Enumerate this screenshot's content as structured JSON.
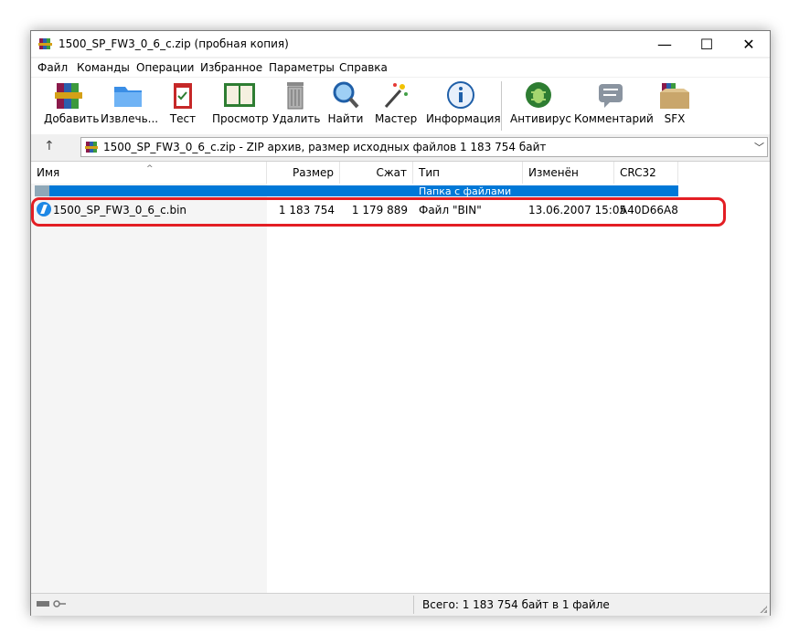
{
  "window": {
    "title": "1500_SP_FW3_0_6_c.zip (пробная копия)",
    "controls": {
      "minimize": "—",
      "maximize": "☐",
      "close": "✕"
    }
  },
  "menu": [
    {
      "label": "Файл"
    },
    {
      "label": "Команды"
    },
    {
      "label": "Операции"
    },
    {
      "label": "Избранное"
    },
    {
      "label": "Параметры"
    },
    {
      "label": "Справка"
    }
  ],
  "toolbar": [
    {
      "label": "Добавить",
      "icon": "add-books-icon"
    },
    {
      "label": "Извлечь...",
      "icon": "extract-folder-icon"
    },
    {
      "label": "Тест",
      "icon": "test-clipboard-icon"
    },
    {
      "label": "Просмотр",
      "icon": "view-book-icon"
    },
    {
      "label": "Удалить",
      "icon": "trash-can-icon"
    },
    {
      "label": "Найти",
      "icon": "magnifier-icon"
    },
    {
      "label": "Мастер",
      "icon": "wizard-wand-icon"
    },
    {
      "label": "Информация",
      "icon": "info-icon"
    },
    {
      "label": "Антивирус",
      "icon": "antivirus-bug-icon"
    },
    {
      "label": "Комментарий",
      "icon": "comment-icon"
    },
    {
      "label": "SFX",
      "icon": "sfx-box-icon"
    }
  ],
  "address": {
    "text": "1500_SP_FW3_0_6_c.zip - ZIP архив, размер исходных файлов 1 183 754 байт"
  },
  "columns": {
    "name": "Имя",
    "size": "Размер",
    "packed": "Сжат",
    "type": "Тип",
    "modified": "Изменён",
    "crc": "CRC32"
  },
  "folder_row": {
    "type": "Папка с файлами"
  },
  "file": {
    "name": "1500_SP_FW3_0_6_c.bin",
    "size": "1 183 754",
    "packed": "1 179 889",
    "type": "Файл \"BIN\"",
    "modified": "13.06.2007 15:05",
    "crc": "A40D66A8"
  },
  "status": {
    "text": "Всего: 1 183 754 байт в 1 файле"
  },
  "colors": {
    "highlight": "#e31e24",
    "selection": "#0078d7"
  }
}
